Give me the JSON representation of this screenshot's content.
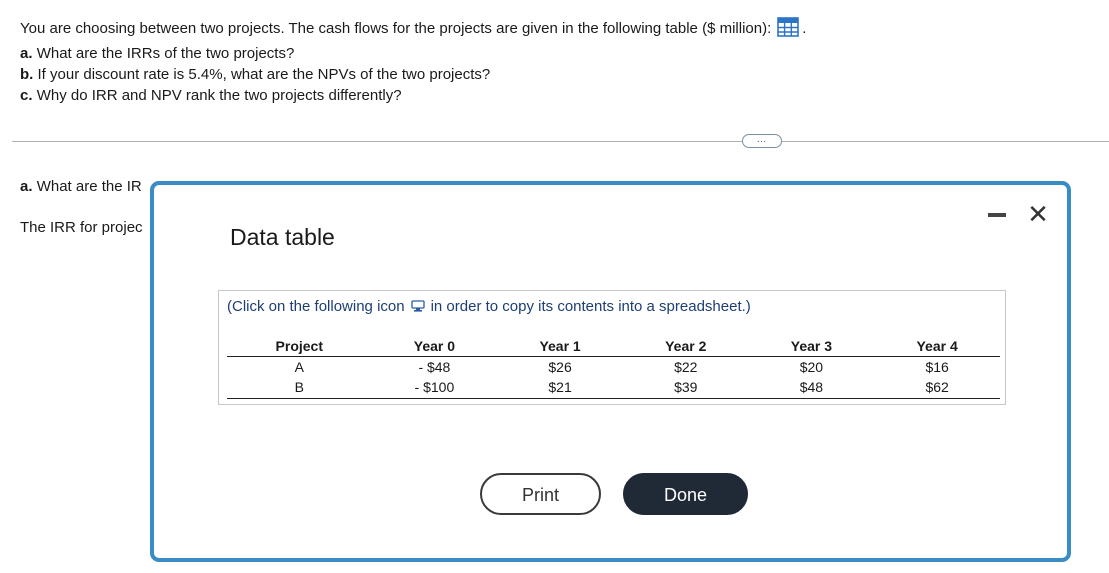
{
  "question": {
    "intro": "You are choosing between two projects. The cash flows for the projects are given in the following table ($ million):",
    "intro_suffix": ".",
    "parts": [
      {
        "label": "a.",
        "text": "What are the IRRs of the two projects?"
      },
      {
        "label": "b.",
        "text": "If your discount rate is 5.4%, what are the NPVs of the two projects?"
      },
      {
        "label": "c.",
        "text": "Why do IRR and NPV rank the two projects differently?"
      }
    ],
    "table_icon": "table-grid-icon"
  },
  "more_button": "…",
  "answer_area": {
    "part_a_label": "a.",
    "part_a_text": "What are the IR",
    "irr_text": "The IRR for projec"
  },
  "dialog": {
    "title": "Data table",
    "minimize_icon": "minimize-icon",
    "close_icon": "close-icon",
    "copy_hint_before": "(Click on the following icon",
    "copy_hint_after": "in order to copy its contents into a spreadsheet.)",
    "copy_icon": "copy-icon",
    "table": {
      "headers": [
        "Project",
        "Year 0",
        "Year 1",
        "Year 2",
        "Year 3",
        "Year 4"
      ],
      "rows": [
        [
          "A",
          "- $48",
          "$26",
          "$22",
          "$20",
          "$16"
        ],
        [
          "B",
          "- $100",
          "$21",
          "$39",
          "$48",
          "$62"
        ]
      ]
    },
    "print_label": "Print",
    "done_label": "Done"
  },
  "colors": {
    "dialog_border": "#3a8cc4",
    "done_button": "#202a36",
    "hint_text": "#1c3e75"
  }
}
